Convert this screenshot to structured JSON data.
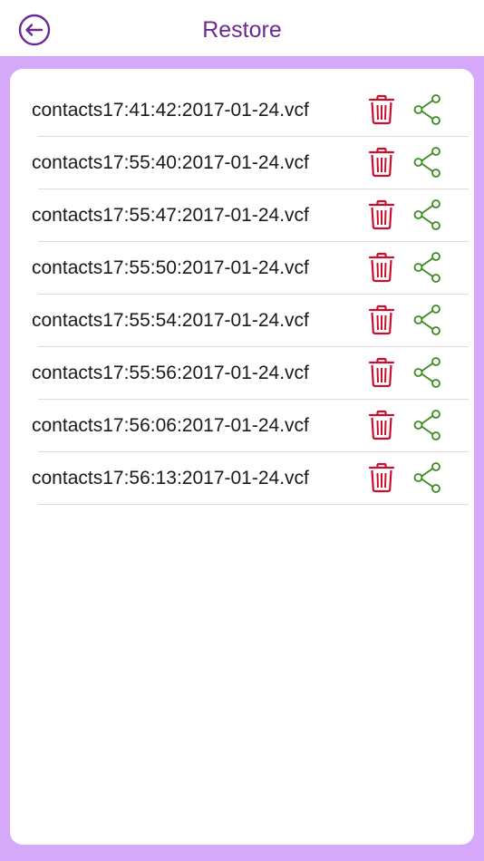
{
  "header": {
    "title": "Restore",
    "back_icon": "arrow-left-circle-icon"
  },
  "colors": {
    "accent": "#6b2a92",
    "background": "#d6a8fa",
    "delete": "#c8102e",
    "share": "#3a8a1e"
  },
  "files": [
    {
      "name": "contacts17:41:42:2017-01-24.vcf"
    },
    {
      "name": "contacts17:55:40:2017-01-24.vcf"
    },
    {
      "name": "contacts17:55:47:2017-01-24.vcf"
    },
    {
      "name": "contacts17:55:50:2017-01-24.vcf"
    },
    {
      "name": "contacts17:55:54:2017-01-24.vcf"
    },
    {
      "name": "contacts17:55:56:2017-01-24.vcf"
    },
    {
      "name": "contacts17:56:06:2017-01-24.vcf"
    },
    {
      "name": "contacts17:56:13:2017-01-24.vcf"
    }
  ]
}
